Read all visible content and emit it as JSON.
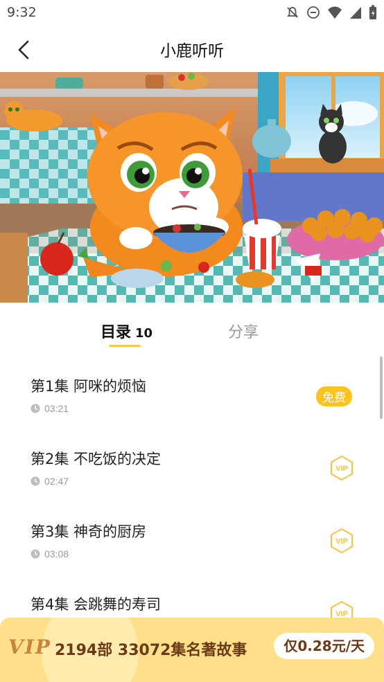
{
  "status": {
    "time": "9:32"
  },
  "header": {
    "title": "小鹿听听"
  },
  "tabs": {
    "catalog_label": "目录",
    "catalog_count": "10",
    "share_label": "分享"
  },
  "episodes": [
    {
      "title": "第1集 阿咪的烦恼",
      "duration": "03:21",
      "badge": "免费"
    },
    {
      "title": "第2集 不吃饭的决定",
      "duration": "02:47",
      "badge": "VIP"
    },
    {
      "title": "第3集 神奇的厨房",
      "duration": "03:08",
      "badge": "VIP"
    },
    {
      "title": "第4集 会跳舞的寿司",
      "duration": "",
      "badge": "VIP"
    }
  ],
  "vip_bar": {
    "logo": "VIP",
    "text": "2194部 33072集名著故事",
    "price": "仅0.28元/天"
  },
  "colors": {
    "accent": "#f9c320",
    "vip_bg": "#ffe08a",
    "vip_text": "#6b3a16"
  }
}
